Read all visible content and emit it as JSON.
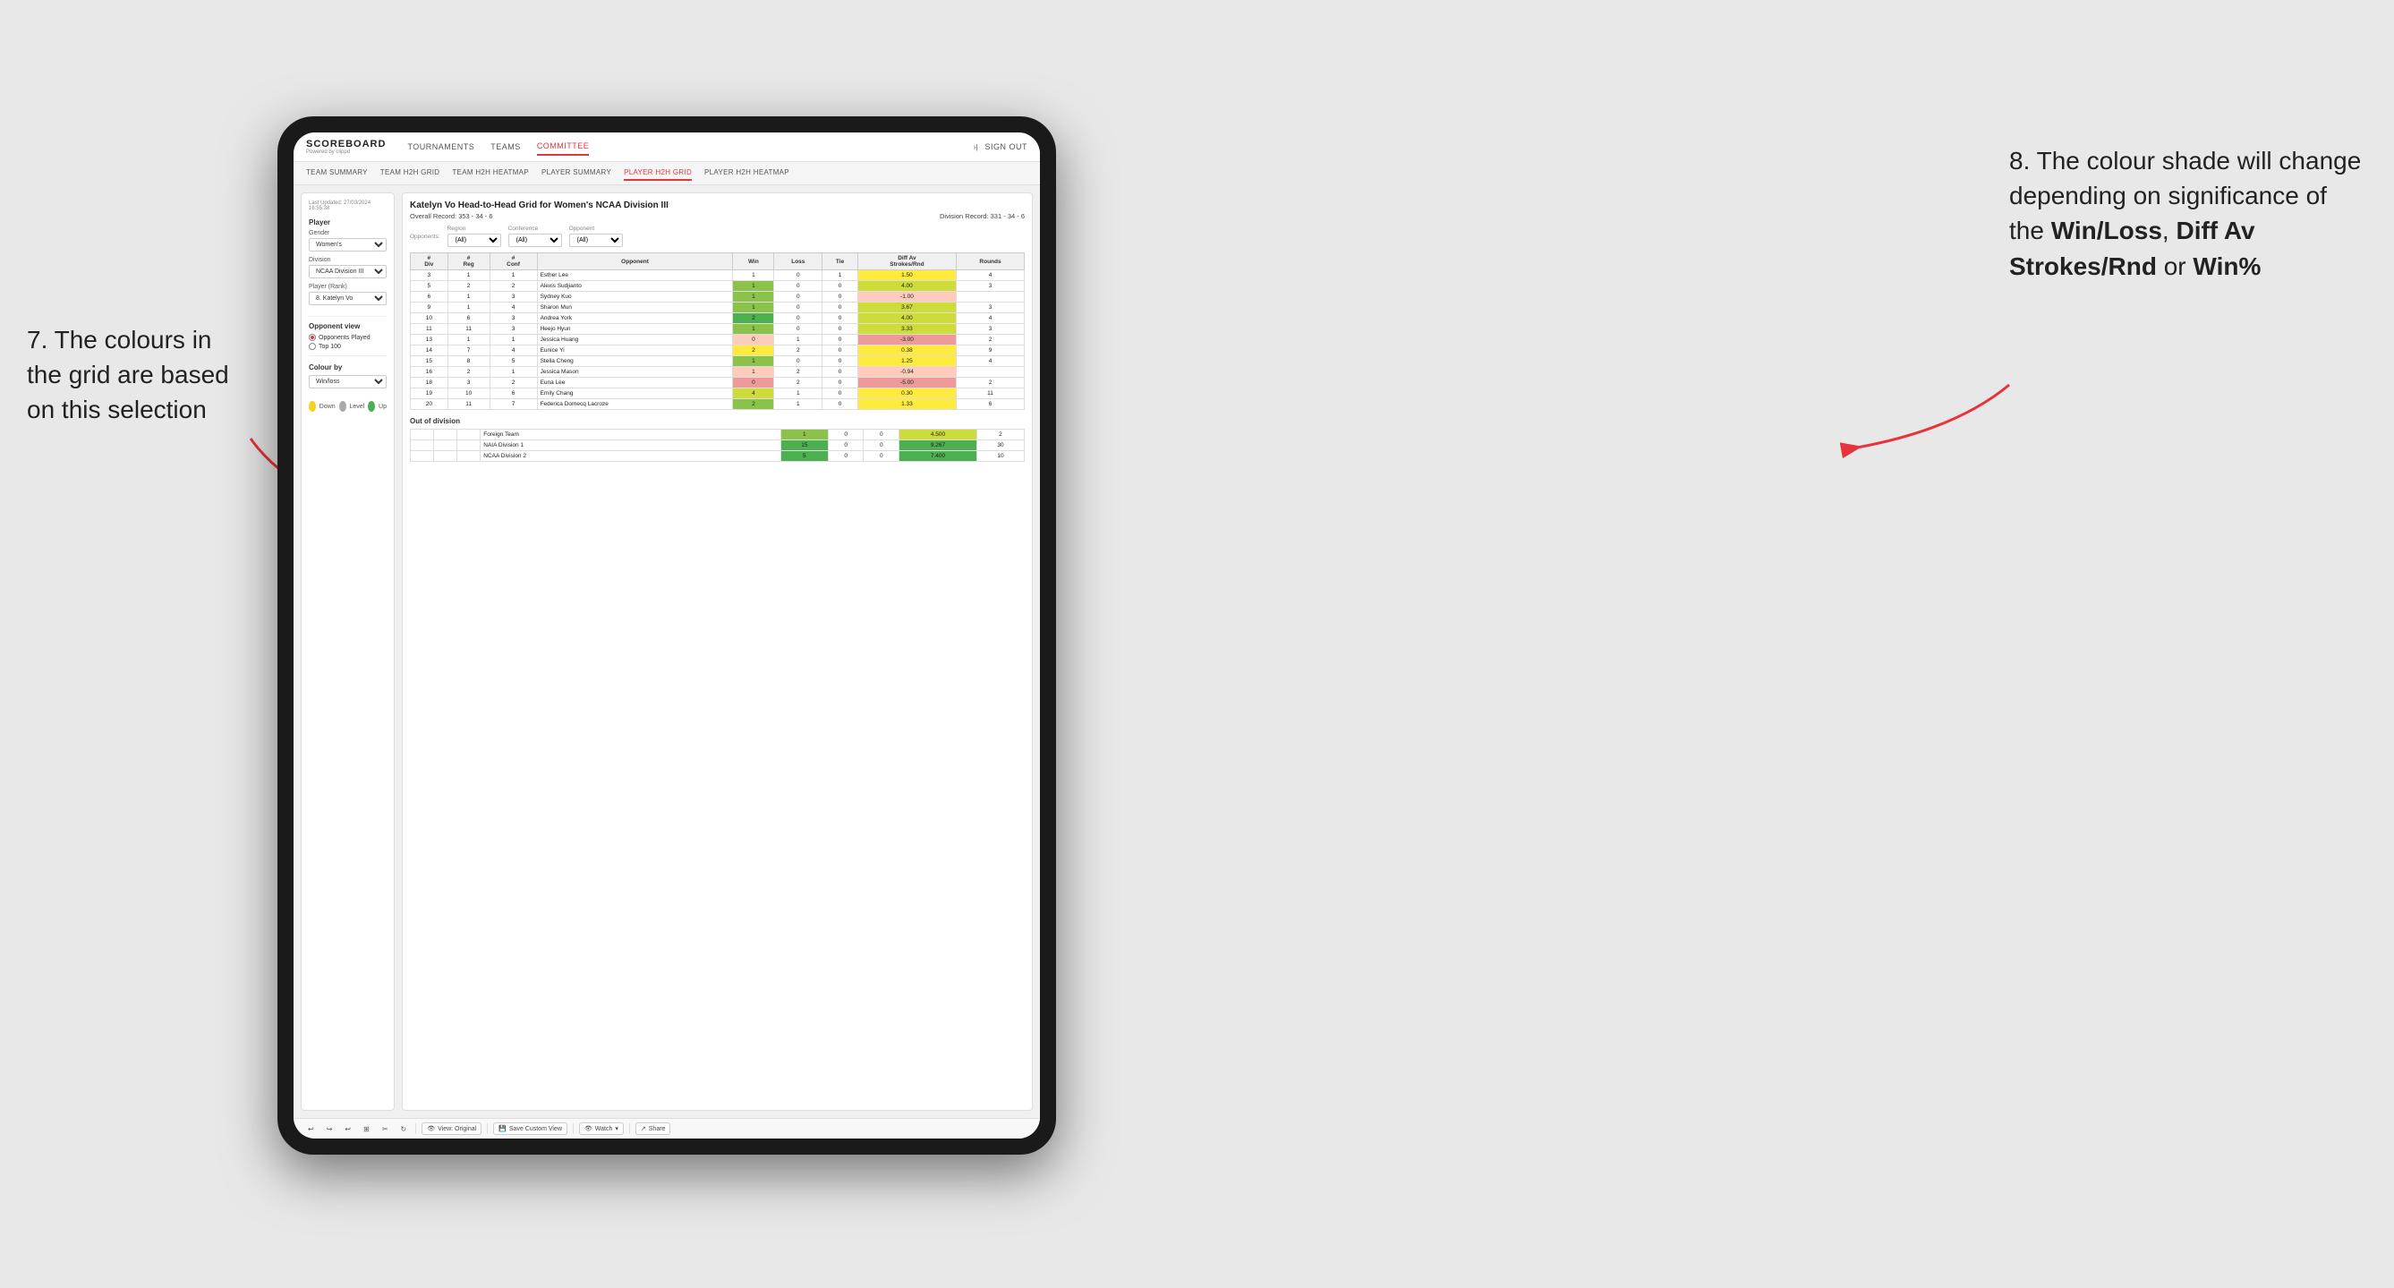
{
  "annotations": {
    "left_text": "7. The colours in the grid are based on this selection",
    "right_text_1": "8. The colour shade will change depending on significance of the ",
    "right_bold_1": "Win/Loss",
    "right_text_2": ", ",
    "right_bold_2": "Diff Av Strokes/Rnd",
    "right_text_3": " or ",
    "right_bold_3": "Win%"
  },
  "nav": {
    "logo": "SCOREBOARD",
    "logo_sub": "Powered by clippd",
    "items": [
      "TOURNAMENTS",
      "TEAMS",
      "COMMITTEE"
    ],
    "active": "COMMITTEE",
    "right": [
      "Sign out"
    ]
  },
  "subnav": {
    "items": [
      "TEAM SUMMARY",
      "TEAM H2H GRID",
      "TEAM H2H HEATMAP",
      "PLAYER SUMMARY",
      "PLAYER H2H GRID",
      "PLAYER H2H HEATMAP"
    ],
    "active": "PLAYER H2H GRID"
  },
  "sidebar": {
    "timestamp": "Last Updated: 27/03/2024 16:55:38",
    "player_label": "Player",
    "gender_label": "Gender",
    "gender_value": "Women's",
    "division_label": "Division",
    "division_value": "NCAA Division III",
    "player_rank_label": "Player (Rank)",
    "player_rank_value": "8. Katelyn Vo",
    "opponent_view_title": "Opponent view",
    "radio1": "Opponents Played",
    "radio2": "Top 100",
    "colour_by_label": "Colour by",
    "colour_by_value": "Win/loss",
    "legend": [
      {
        "color": "#f5d020",
        "label": "Down"
      },
      {
        "color": "#aaaaaa",
        "label": "Level"
      },
      {
        "color": "#4caf50",
        "label": "Up"
      }
    ]
  },
  "grid": {
    "title": "Katelyn Vo Head-to-Head Grid for Women's NCAA Division III",
    "overall_record_label": "Overall Record:",
    "overall_record": "353 - 34 - 6",
    "division_record_label": "Division Record:",
    "division_record": "331 - 34 - 6",
    "filters": {
      "opponents_label": "Opponents:",
      "region_label": "Region",
      "region_value": "(All)",
      "conference_label": "Conference",
      "conference_value": "(All)",
      "opponent_label": "Opponent",
      "opponent_value": "(All)"
    },
    "col_headers": [
      "#\nDiv",
      "#\nReg",
      "#\nConf",
      "Opponent",
      "Win",
      "Loss",
      "Tie",
      "Diff Av\nStrokes/Rnd",
      "Rounds"
    ],
    "rows": [
      {
        "div": 3,
        "reg": 1,
        "conf": 1,
        "opponent": "Esther Lee",
        "win": 1,
        "loss": 0,
        "tie": 1,
        "diff": "1.50",
        "rounds": 4,
        "win_color": "white",
        "diff_color": "yellow"
      },
      {
        "div": 5,
        "reg": 2,
        "conf": 2,
        "opponent": "Alexis Sudjianto",
        "win": 1,
        "loss": 0,
        "tie": 0,
        "diff": "4.00",
        "rounds": 3,
        "win_color": "green_med",
        "diff_color": "green_light"
      },
      {
        "div": 6,
        "reg": 1,
        "conf": 3,
        "opponent": "Sydney Kuo",
        "win": 1,
        "loss": 0,
        "tie": 0,
        "diff": "-1.00",
        "rounds": "",
        "win_color": "green_med",
        "diff_color": "red_light"
      },
      {
        "div": 9,
        "reg": 1,
        "conf": 4,
        "opponent": "Sharon Mun",
        "win": 1,
        "loss": 0,
        "tie": 0,
        "diff": "3.67",
        "rounds": 3,
        "win_color": "green_med",
        "diff_color": "green_light"
      },
      {
        "div": 10,
        "reg": 6,
        "conf": 3,
        "opponent": "Andrea York",
        "win": 2,
        "loss": 0,
        "tie": 0,
        "diff": "4.00",
        "rounds": 4,
        "win_color": "green_dark",
        "diff_color": "green_light"
      },
      {
        "div": 11,
        "reg": 11,
        "conf": 3,
        "opponent": "Heejo Hyun",
        "win": 1,
        "loss": 0,
        "tie": 0,
        "diff": "3.33",
        "rounds": 3,
        "win_color": "green_med",
        "diff_color": "green_light"
      },
      {
        "div": 13,
        "reg": 1,
        "conf": 1,
        "opponent": "Jessica Huang",
        "win": 0,
        "loss": 1,
        "tie": 0,
        "diff": "-3.00",
        "rounds": 2,
        "win_color": "red_light",
        "diff_color": "red"
      },
      {
        "div": 14,
        "reg": 7,
        "conf": 4,
        "opponent": "Eunice Yi",
        "win": 2,
        "loss": 2,
        "tie": 0,
        "diff": "0.38",
        "rounds": 9,
        "win_color": "yellow",
        "diff_color": "yellow"
      },
      {
        "div": 15,
        "reg": 8,
        "conf": 5,
        "opponent": "Stella Cheng",
        "win": 1,
        "loss": 0,
        "tie": 0,
        "diff": "1.25",
        "rounds": 4,
        "win_color": "green_med",
        "diff_color": "yellow"
      },
      {
        "div": 16,
        "reg": 2,
        "conf": 1,
        "opponent": "Jessica Mason",
        "win": 1,
        "loss": 2,
        "tie": 0,
        "diff": "-0.94",
        "rounds": "",
        "win_color": "red_light",
        "diff_color": "red_light"
      },
      {
        "div": 18,
        "reg": 3,
        "conf": 2,
        "opponent": "Euna Lee",
        "win": 0,
        "loss": 2,
        "tie": 0,
        "diff": "-5.00",
        "rounds": 2,
        "win_color": "red",
        "diff_color": "red"
      },
      {
        "div": 19,
        "reg": 10,
        "conf": 6,
        "opponent": "Emily Chang",
        "win": 4,
        "loss": 1,
        "tie": 0,
        "diff": "0.30",
        "rounds": 11,
        "win_color": "green_light",
        "diff_color": "yellow"
      },
      {
        "div": 20,
        "reg": 11,
        "conf": 7,
        "opponent": "Federica Domecq Lacroze",
        "win": 2,
        "loss": 1,
        "tie": 0,
        "diff": "1.33",
        "rounds": 6,
        "win_color": "green_med",
        "diff_color": "yellow"
      }
    ],
    "out_of_division_title": "Out of division",
    "out_of_division_rows": [
      {
        "opponent": "Foreign Team",
        "win": 1,
        "loss": 0,
        "tie": 0,
        "diff": "4.500",
        "rounds": 2,
        "win_color": "green_med",
        "diff_color": "green_light"
      },
      {
        "opponent": "NAIA Division 1",
        "win": 15,
        "loss": 0,
        "tie": 0,
        "diff": "9.267",
        "rounds": 30,
        "win_color": "green_dark",
        "diff_color": "green_dark"
      },
      {
        "opponent": "NCAA Division 2",
        "win": 5,
        "loss": 0,
        "tie": 0,
        "diff": "7.400",
        "rounds": 10,
        "win_color": "green_dark",
        "diff_color": "green_dark"
      }
    ]
  },
  "toolbar": {
    "view_original": "View: Original",
    "save_custom": "Save Custom View",
    "watch": "Watch",
    "share": "Share"
  }
}
